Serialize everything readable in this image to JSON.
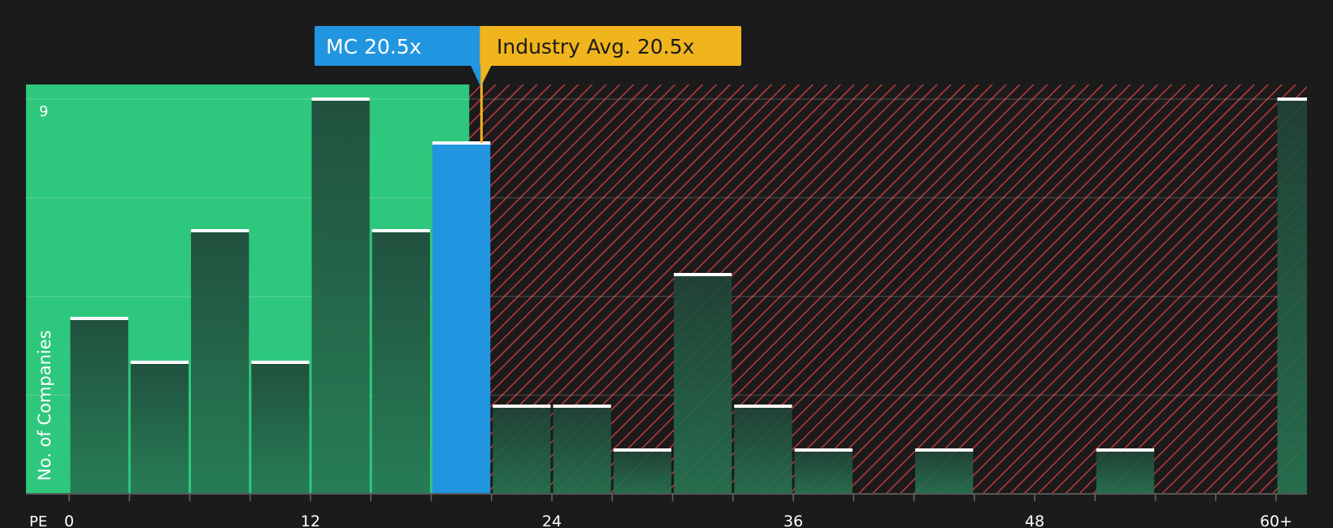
{
  "colors": {
    "background": "#1b1b1b",
    "undervalued_zone": "#2ec77e",
    "overvalued_hatch": "#c0393b",
    "company": "#2295e0",
    "industry": "#f0b41c",
    "bar_fill_top": "#1f4437",
    "bar_fill_bottom": "#267552",
    "text": "#ffffff"
  },
  "labels": {
    "company_tag": "MC 20.5x",
    "industry_tag": "Industry Avg. 20.5x"
  },
  "chart_data": {
    "type": "bar",
    "title": "",
    "xlabel": "PE",
    "ylabel": "No. of Companies",
    "ylim": [
      0,
      9
    ],
    "y_ticks": [
      "9"
    ],
    "x_ticks": [
      "0",
      "12",
      "24",
      "36",
      "48",
      "60+"
    ],
    "x_tick_values": [
      0,
      12,
      24,
      36,
      48,
      60
    ],
    "bin_width": 3,
    "bins": [
      {
        "x0": 0,
        "value": 4
      },
      {
        "x0": 3,
        "value": 3
      },
      {
        "x0": 6,
        "value": 6
      },
      {
        "x0": 9,
        "value": 3
      },
      {
        "x0": 12,
        "value": 9
      },
      {
        "x0": 15,
        "value": 6
      },
      {
        "x0": 18,
        "value": 8,
        "highlight": "company"
      },
      {
        "x0": 21,
        "value": 2
      },
      {
        "x0": 24,
        "value": 2
      },
      {
        "x0": 27,
        "value": 1
      },
      {
        "x0": 30,
        "value": 5
      },
      {
        "x0": 33,
        "value": 2
      },
      {
        "x0": 36,
        "value": 1
      },
      {
        "x0": 42,
        "value": 1
      },
      {
        "x0": 51,
        "value": 1
      },
      {
        "x0": 60,
        "value": 9
      }
    ],
    "company_pe": 20.5,
    "industry_avg_pe": 20.5,
    "grid": true
  }
}
